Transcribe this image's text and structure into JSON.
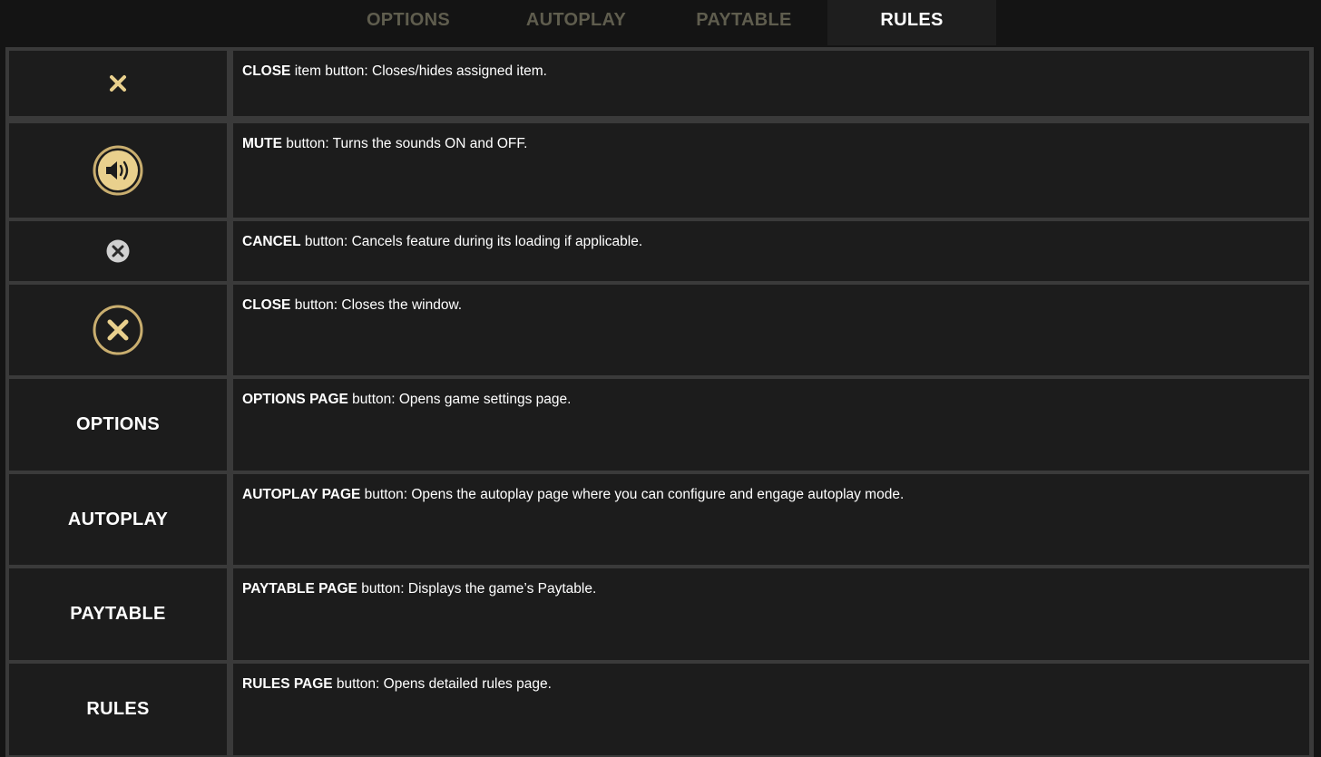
{
  "tabs": [
    {
      "label": "OPTIONS",
      "active": false
    },
    {
      "label": "AUTOPLAY",
      "active": false
    },
    {
      "label": "PAYTABLE",
      "active": false
    },
    {
      "label": "RULES",
      "active": true
    }
  ],
  "colors": {
    "accent_gold": "#e9d08d",
    "gold_ring": "#c9ae6f",
    "panel_bg": "#1c1c1c",
    "grid_line": "#3a3a3a",
    "inactive_tab": "#5f5d4e",
    "cancel_gray": "#d0d0d0"
  },
  "rows": [
    {
      "icon": "close-item-x-icon",
      "bold": "CLOSE",
      "text": " item button: Closes/hides assigned item."
    },
    {
      "icon": "speaker-mute-icon",
      "bold": "MUTE",
      "text": " button: Turns the sounds ON and OFF."
    },
    {
      "icon": "cancel-circle-x-icon",
      "bold": "CANCEL",
      "text": " button: Cancels feature during its loading if applicable."
    },
    {
      "icon": "close-circle-x-icon",
      "bold": "CLOSE",
      "text": " button: Closes the window."
    },
    {
      "label": "OPTIONS",
      "bold": "OPTIONS PAGE",
      "text": " button: Opens game settings page."
    },
    {
      "label": "AUTOPLAY",
      "bold": "AUTOPLAY PAGE",
      "text": " button: Opens the autoplay page where you can configure and engage autoplay mode."
    },
    {
      "label": "PAYTABLE",
      "bold": "PAYTABLE PAGE",
      "text": " button: Displays the game’s Paytable."
    },
    {
      "label": "RULES",
      "bold": "RULES PAGE",
      "text": " button: Opens detailed rules page."
    }
  ]
}
